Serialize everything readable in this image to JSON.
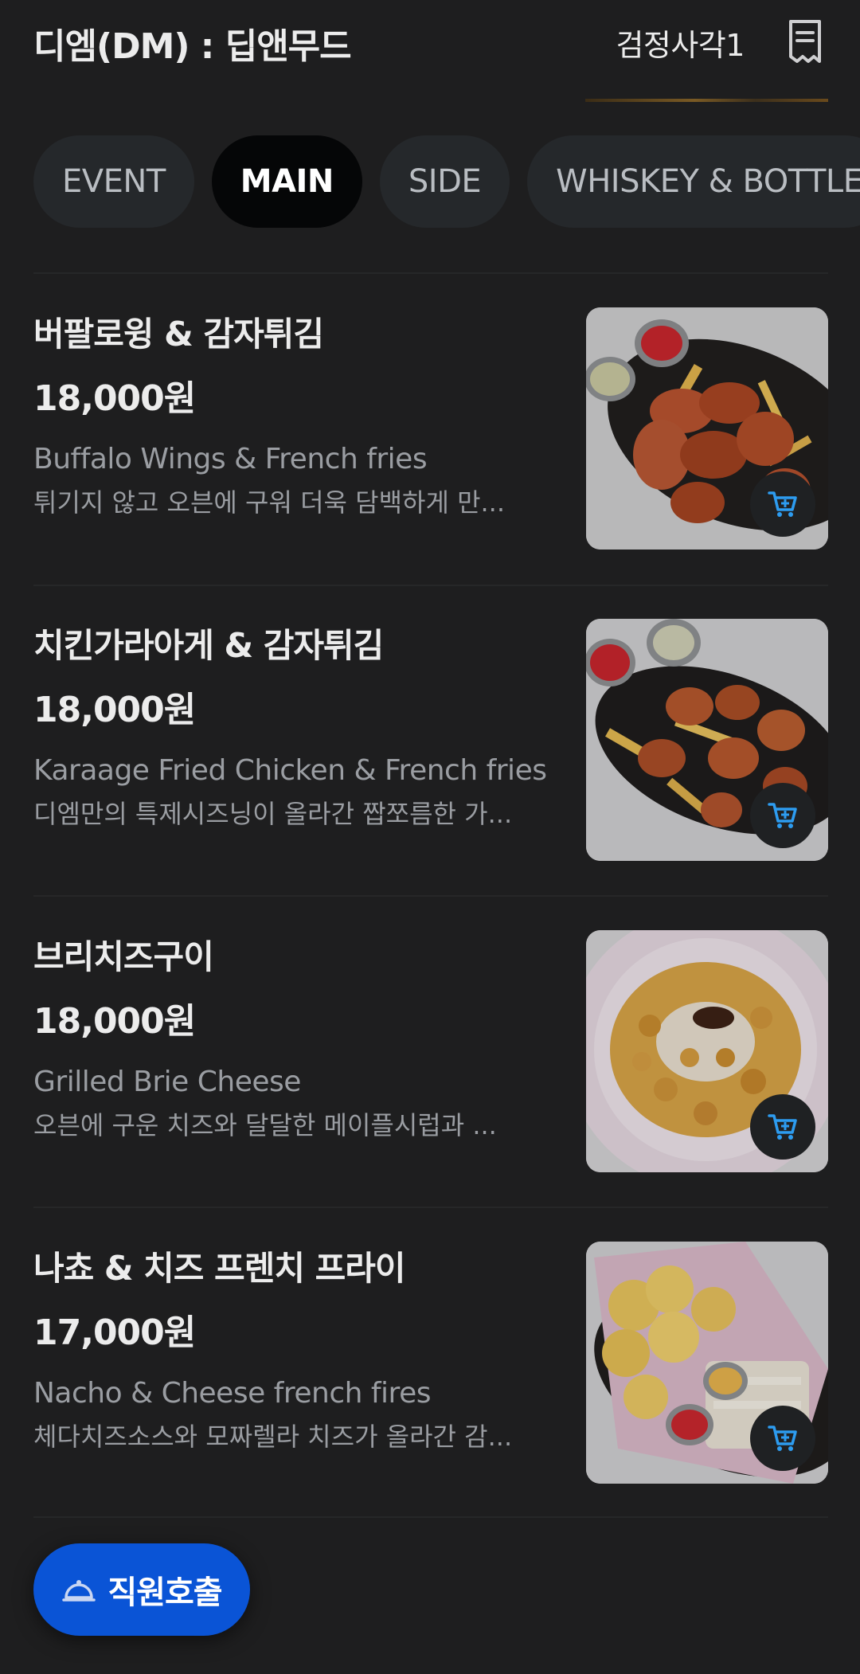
{
  "header": {
    "store_name": "디엠(DM) : 딥앤무드",
    "table_name": "검정사각1",
    "receipt_icon": "receipt-icon"
  },
  "tabs": [
    {
      "label": "EVENT",
      "active": false
    },
    {
      "label": "MAIN",
      "active": true
    },
    {
      "label": "SIDE",
      "active": false
    },
    {
      "label": "WHISKEY & BOTTLE",
      "active": false
    }
  ],
  "menu": [
    {
      "name": "버팔로윙 & 감자튀김",
      "price": "18,000원",
      "name_en": "Buffalo Wings & French fries",
      "desc": "튀기지 않고 오븐에 구워 더욱 담백하게 만...",
      "photo": "buffalo-wings-fries-photo"
    },
    {
      "name": "치킨가라아게 & 감자튀김",
      "price": "18,000원",
      "name_en": "Karaage Fried Chicken & French fries",
      "desc": "디엠만의 특제시즈닝이 올라간 짭쪼름한 가...",
      "photo": "karaage-fries-photo"
    },
    {
      "name": "브리치즈구이",
      "price": "18,000원",
      "name_en": "Grilled Brie Cheese",
      "desc": "오븐에 구운 치즈와 달달한 메이플시럽과 ...",
      "photo": "grilled-brie-photo"
    },
    {
      "name": "나쵸 & 치즈 프렌치 프라이",
      "price": "17,000원",
      "name_en": "Nacho & Cheese french fires",
      "desc": "체다치즈소스와 모짜렐라 치즈가 올라간 감...",
      "photo": "nacho-cheese-fries-photo"
    }
  ],
  "staff_call": {
    "label": "직원호출",
    "icon": "bell-icon"
  },
  "colors": {
    "background": "#1e1e1f",
    "tab_active": "#050607",
    "tab_inactive": "#25282b",
    "cart_icon": "#2d9cf0",
    "staff_call": "#0a54d6"
  }
}
